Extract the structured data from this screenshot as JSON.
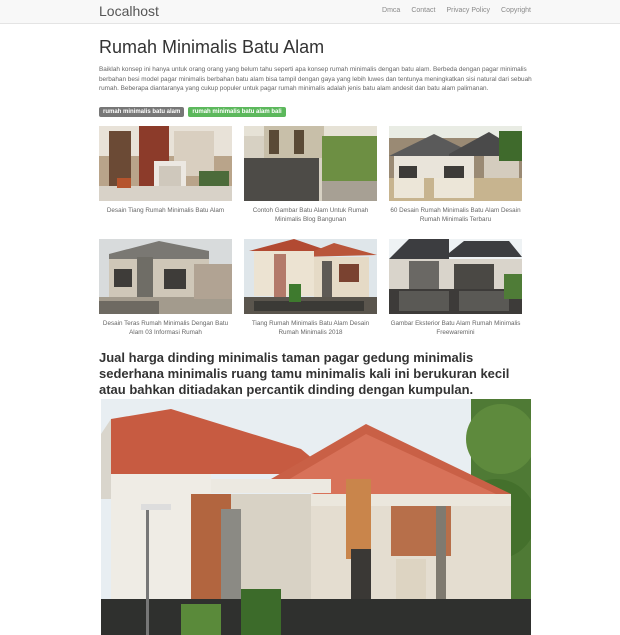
{
  "nav": {
    "brand": "Localhost",
    "links": [
      "Dmca",
      "Contact",
      "Privacy Policy",
      "Copyright"
    ]
  },
  "page": {
    "title": "Rumah Minimalis Batu Alam",
    "intro": "Baiklah konsep ini hanya untuk orang orang yang belum tahu seperti apa konsep rumah minimalis dengan batu alam. Berbeda dengan pagar minimalis berbahan besi model pagar minimalis berbahan batu alam bisa tampil dengan gaya yang lebih luwes dan tentunya meningkatkan sisi natural dari sebuah rumah. Beberapa diantaranya yang cukup populer untuk pagar rumah minimalis adalah jenis batu alam andesit dan batu alam palimanan.",
    "tags": [
      "rumah minimalis batu alam",
      "rumah minimalis batu alam bali"
    ],
    "subheading": "Jual harga dinding minimalis taman pagar gedung minimalis sederhana minimalis ruang tamu minimalis kali ini berukuran kecil atau bahkan ditiadakan percantik dinding dengan kumpulan."
  },
  "gallery": [
    {
      "caption": "Desain Tiang Rumah Minimalis Batu Alam"
    },
    {
      "caption": "Contoh Gambar Batu Alam Untuk Rumah Minimalis Blog Bangunan"
    },
    {
      "caption": "60 Desain Rumah Minimalis Batu Alam Desain Rumah Minimalis Terbaru"
    },
    {
      "caption": "Desain Teras Rumah Minimalis Dengan Batu Alam 03 Informasi Rumah"
    },
    {
      "caption": "Tiang Rumah Minimalis Batu Alam Desain Rumah Minimalis 2018"
    },
    {
      "caption": "Gambar Eksterior Batu Alam Rumah Minimalis Freewaremini"
    }
  ]
}
